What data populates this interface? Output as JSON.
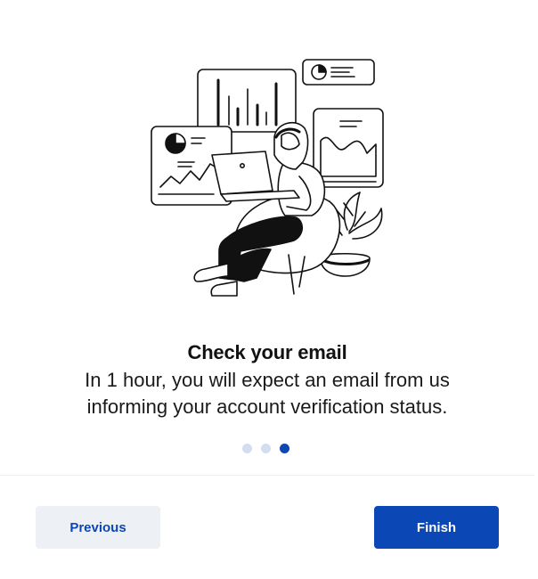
{
  "onboarding": {
    "illustration_icon": "person-with-laptop-and-charts-illustration",
    "title": "Check your email",
    "description": "In 1 hour, you will expect an email from us informing your account verification status.",
    "pagination": {
      "total": 3,
      "current": 3
    }
  },
  "footer": {
    "previous_label": "Previous",
    "finish_label": "Finish"
  },
  "colors": {
    "primary": "#0b47b5",
    "dot_inactive": "#d3ddf0",
    "secondary_button_bg": "#edf0f4"
  }
}
